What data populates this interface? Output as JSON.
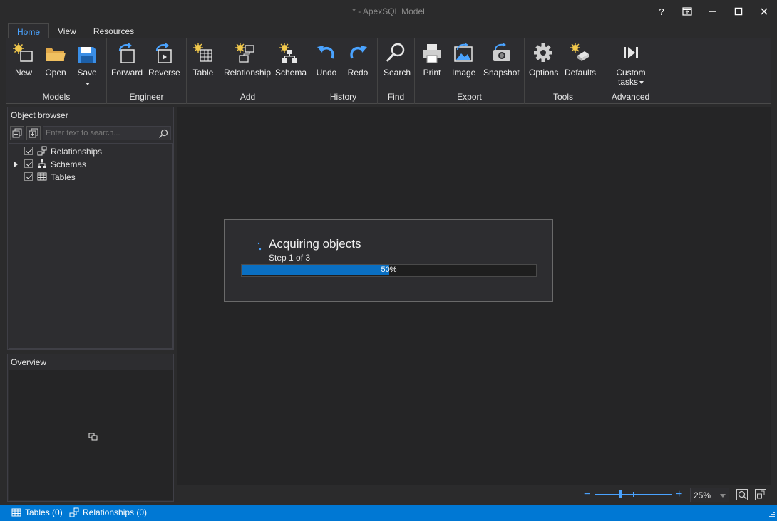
{
  "window": {
    "title": "* - ApexSQL Model"
  },
  "window_buttons": [
    "?",
    "⇱",
    "—",
    "☐",
    "✕"
  ],
  "tabs": [
    {
      "label": "Home",
      "active": true
    },
    {
      "label": "View",
      "active": false
    },
    {
      "label": "Resources",
      "active": false
    }
  ],
  "ribbon": {
    "groups": {
      "models": "Models",
      "engineer": "Engineer",
      "add": "Add",
      "history": "History",
      "find": "Find",
      "export": "Export",
      "tools": "Tools",
      "advanced": "Advanced"
    },
    "buttons": {
      "new": "New",
      "open": "Open",
      "save": "Save",
      "forward": "Forward",
      "reverse": "Reverse",
      "table": "Table",
      "relationship": "Relationship",
      "schema": "Schema",
      "undo": "Undo",
      "redo": "Redo",
      "search": "Search",
      "print": "Print",
      "image": "Image",
      "snapshot": "Snapshot",
      "options": "Options",
      "defaults": "Defaults",
      "custom_tasks_line1": "Custom",
      "custom_tasks_line2": "tasks"
    }
  },
  "object_browser": {
    "title": "Object browser",
    "search_placeholder": "Enter text to search...",
    "nodes": [
      {
        "label": "Relationships",
        "checked": true,
        "expandable": false,
        "icon": "relationship-icon"
      },
      {
        "label": "Schemas",
        "checked": true,
        "expandable": true,
        "icon": "schema-icon"
      },
      {
        "label": "Tables",
        "checked": true,
        "expandable": false,
        "icon": "table-icon"
      }
    ]
  },
  "overview": {
    "title": "Overview"
  },
  "progress": {
    "title": "Acquiring objects",
    "step": "Step 1 of 3",
    "percent_label": "50%",
    "percent": 50
  },
  "zoom": {
    "minus": "−",
    "plus": "+",
    "value": "25%",
    "slider_fraction": 0.31
  },
  "status": {
    "tables": "Tables (0)",
    "relationships": "Relationships (0)"
  },
  "colors": {
    "accent": "#0078d4",
    "progress": "#0a6fc2",
    "link": "#4aa3ff"
  }
}
